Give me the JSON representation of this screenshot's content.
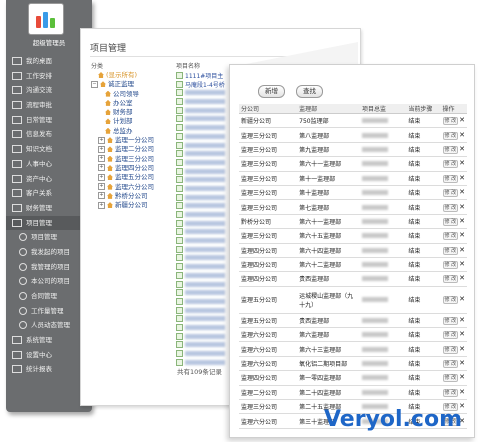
{
  "app": {
    "title": "超级管理员"
  },
  "sidebar": {
    "items": [
      {
        "label": "我的桌面",
        "icon": "desktop-icon"
      },
      {
        "label": "工作安排",
        "icon": "calendar-icon"
      },
      {
        "label": "沟通交流",
        "icon": "chat-icon"
      },
      {
        "label": "流程审批",
        "icon": "flow-icon"
      },
      {
        "label": "日常管理",
        "icon": "gear-icon"
      },
      {
        "label": "信息发布",
        "icon": "doc-icon"
      },
      {
        "label": "知识文档",
        "icon": "folder-icon"
      },
      {
        "label": "人事中心",
        "icon": "user-icon"
      },
      {
        "label": "资产中心",
        "icon": "box-icon"
      },
      {
        "label": "客户关系",
        "icon": "people-icon"
      },
      {
        "label": "财务管理",
        "icon": "money-icon"
      },
      {
        "label": "项目管理",
        "icon": "gear-icon",
        "active": true
      },
      {
        "label": "项目管理",
        "icon": "gear-icon",
        "sub": true
      },
      {
        "label": "我发起的项目",
        "icon": "gear-icon",
        "sub": true
      },
      {
        "label": "我管理的项目",
        "icon": "gear-icon",
        "sub": true
      },
      {
        "label": "本公司的项目",
        "icon": "gear-icon",
        "sub": true
      },
      {
        "label": "合同管理",
        "icon": "gear-icon",
        "sub": true
      },
      {
        "label": "工作量管理",
        "icon": "folder-icon",
        "sub": true
      },
      {
        "label": "人员动态管理",
        "icon": "gear-icon",
        "sub": true
      },
      {
        "label": "系统管理",
        "icon": "gear-icon"
      },
      {
        "label": "设置中心",
        "icon": "wrench-icon"
      },
      {
        "label": "统计报表",
        "icon": "chart-icon"
      }
    ]
  },
  "main": {
    "title": "项目管理",
    "tree_header": "分类",
    "list_header": "项目名称",
    "tree": [
      {
        "label": "(显示所有)",
        "indent": 1,
        "pm": "",
        "home": true,
        "color": "#d8952a"
      },
      {
        "label": "诚正监理",
        "indent": 0,
        "pm": "−",
        "home": true
      },
      {
        "label": "公司领导",
        "indent": 2,
        "pm": "",
        "home": true
      },
      {
        "label": "办公室",
        "indent": 2,
        "pm": "",
        "home": true
      },
      {
        "label": "财务部",
        "indent": 2,
        "pm": "",
        "home": true
      },
      {
        "label": "计划部",
        "indent": 2,
        "pm": "",
        "home": true
      },
      {
        "label": "总监办",
        "indent": 2,
        "pm": "",
        "home": true
      },
      {
        "label": "监理一分公司",
        "indent": 1,
        "pm": "+",
        "home": true
      },
      {
        "label": "监理二分公司",
        "indent": 1,
        "pm": "+",
        "home": true
      },
      {
        "label": "监理三分公司",
        "indent": 1,
        "pm": "+",
        "home": true
      },
      {
        "label": "监理四分公司",
        "indent": 1,
        "pm": "+",
        "home": true
      },
      {
        "label": "监理五分公司",
        "indent": 1,
        "pm": "+",
        "home": true
      },
      {
        "label": "监理六分公司",
        "indent": 1,
        "pm": "+",
        "home": true
      },
      {
        "label": "黔桥分公司",
        "indent": 1,
        "pm": "+",
        "home": true
      },
      {
        "label": "新疆分公司",
        "indent": 1,
        "pm": "+",
        "home": true
      }
    ],
    "projects": [
      "1111#项目主",
      "马庵段1-4号桥",
      "",
      "",
      "",
      "",
      "",
      "",
      "",
      "",
      "",
      "",
      "",
      "",
      "",
      "",
      "",
      "",
      "",
      "",
      "",
      "",
      "",
      "",
      "",
      "",
      "",
      "",
      "",
      "",
      "",
      "",
      "",
      ""
    ],
    "total": "共有109条记录"
  },
  "panel": {
    "buttons": {
      "add": "新增",
      "search": "查找"
    },
    "columns": [
      "分公司",
      "监理部",
      "项目总监",
      "当前步骤",
      "操作"
    ],
    "rows": [
      {
        "company": "新疆分公司",
        "dept": "750监理部",
        "step": "结束"
      },
      {
        "company": "监理三分公司",
        "dept": "第八监理部",
        "step": "结束"
      },
      {
        "company": "监理三分公司",
        "dept": "第九监理部",
        "step": "结束"
      },
      {
        "company": "监理三分公司",
        "dept": "第六十一监理部",
        "step": "结束"
      },
      {
        "company": "监理三分公司",
        "dept": "第十一监理部",
        "step": "结束"
      },
      {
        "company": "监理三分公司",
        "dept": "第十监理部",
        "step": "结束"
      },
      {
        "company": "监理三分公司",
        "dept": "第七监理部",
        "step": "结束"
      },
      {
        "company": "黔桥分公司",
        "dept": "第六十一监理部",
        "step": "结束"
      },
      {
        "company": "监理三分公司",
        "dept": "第六十五监理部",
        "step": "结束"
      },
      {
        "company": "监理四分公司",
        "dept": "第六十四监理部",
        "step": "结束"
      },
      {
        "company": "监理四分公司",
        "dept": "第六十二监理部",
        "step": "结束"
      },
      {
        "company": "监理四分公司",
        "dept": "贵西监理部",
        "step": "结束"
      },
      {
        "company": "监理五分公司",
        "dept": "运城稷山监理部（九十九）",
        "step": "结束",
        "tall": true
      },
      {
        "company": "监理五分公司",
        "dept": "贵西监理部",
        "step": "结束"
      },
      {
        "company": "监理六分公司",
        "dept": "第六监理部",
        "step": "结束"
      },
      {
        "company": "监理六分公司",
        "dept": "第六十三监理部",
        "step": "结束"
      },
      {
        "company": "监理六分公司",
        "dept": "氧化铝二期项目部",
        "step": "结束"
      },
      {
        "company": "监理四分公司",
        "dept": "第一零四监理部",
        "step": "结束"
      },
      {
        "company": "监理二分公司",
        "dept": "第二十四监理部",
        "step": "结束"
      },
      {
        "company": "监理三分公司",
        "dept": "第二十五监理部",
        "step": "结束"
      },
      {
        "company": "监理六分公司",
        "dept": "第三十监理部",
        "step": "结束"
      }
    ],
    "edit_label": "修 改",
    "delete_glyph": "✕"
  },
  "watermark": "Veryol.com",
  "colors": {
    "sidebar": "#6b6d6f",
    "link": "#244a8c",
    "watermark": "#1e66c7"
  }
}
